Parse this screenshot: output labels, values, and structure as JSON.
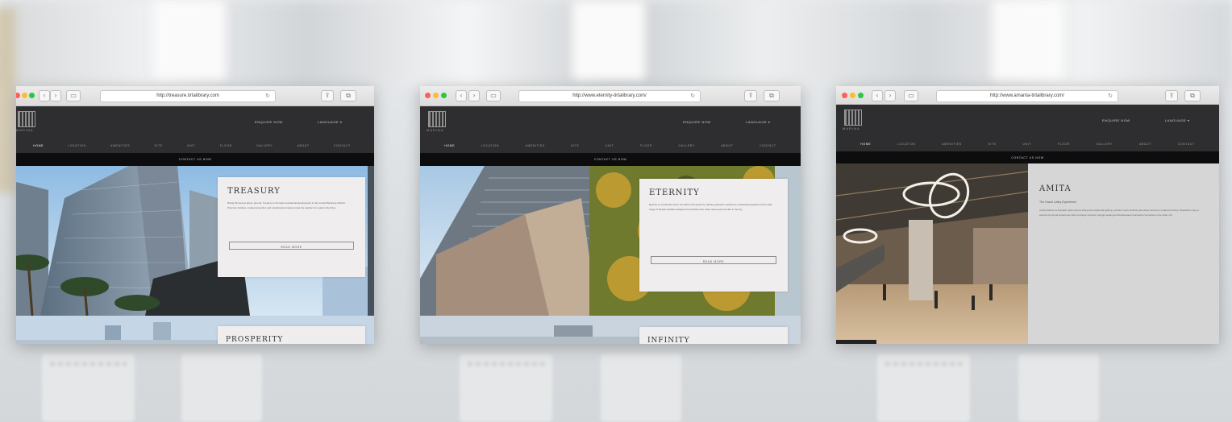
{
  "windows": [
    {
      "url": "http://treasure.tirtalibrary.com",
      "header": {
        "logo_sub": "MARINA",
        "link_one": "ENQUIRE NOW",
        "link_two": "LANGUAGE ▾"
      },
      "nav": [
        "HOME",
        "LOCATION",
        "AMENITIES",
        "SITE",
        "UNIT",
        "FLOOR",
        "GALLERY",
        "ABOUT",
        "CONTACT"
      ],
      "subbar": "CONTACT US NOW",
      "card": {
        "title": "TREASURY",
        "body": "Rising 50 storeys above ground, Treasury is the latest residential development in the Central Business District. Premium finishes, curated amenities and unobstructed views across the skyline for modern city living.",
        "button": "READ MORE"
      },
      "next_card": {
        "title": "PROSPERITY"
      },
      "colors": {
        "header": "#2e2e30",
        "card": "#efeded"
      }
    },
    {
      "url": "http://www.eternity-tirtalibrary.com/",
      "header": {
        "logo_sub": "MARINA",
        "link_one": "ENQUIRE NOW",
        "link_two": "LANGUAGE ▾"
      },
      "nav": [
        "HOME",
        "LOCATION",
        "AMENITIES",
        "SITE",
        "UNIT",
        "FLOOR",
        "GALLERY",
        "ABOUT",
        "CONTACT"
      ],
      "subbar": "CONTACT US NOW",
      "card": {
        "title": "ETERNITY",
        "body": "Eternity is a landmark tower set within lush greenery, offering spacious residences, landscaped gardens and a wide range of lifestyle facilities designed for families who value nature and comfort in the city.",
        "button": "READ MORE"
      },
      "next_card": {
        "title": "INFINITY"
      },
      "colors": {
        "header": "#2e2e30",
        "card": "#efeded"
      }
    },
    {
      "url": "http://www.amanta-tirtalibrary.com/",
      "header": {
        "logo_sub": "MARINA",
        "link_one": "ENQUIRE NOW",
        "link_two": "LANGUAGE ▾"
      },
      "nav": [
        "HOME",
        "LOCATION",
        "AMENITIES",
        "SITE",
        "UNIT",
        "FLOOR",
        "GALLERY",
        "ABOUT",
        "CONTACT"
      ],
      "subbar": "CONTACT US NOW",
      "card": {
        "title": "AMITA",
        "subtitle": "The Grand Lobby Experience",
        "body": "Amita features a dramatic triple-volume lobby with sculptural lighting, premium stone finishes and direct access to retail and dining. Residents enjoy a welcoming arrival experience with concierge services, lounge seating and landscaped courtyards connected to the wider city."
      },
      "colors": {
        "header": "#2e2e30",
        "panel": "#d6d6d6"
      }
    }
  ]
}
